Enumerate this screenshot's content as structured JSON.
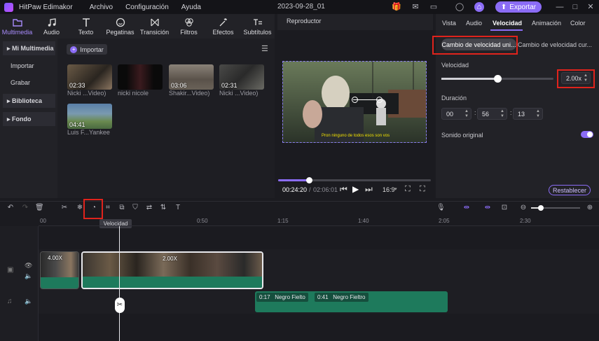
{
  "app": {
    "name": "HitPaw Edimakor",
    "menus": [
      "Archivo",
      "Configuración",
      "Ayuda"
    ],
    "doc_title": "2023-09-28_01",
    "export_label": "Exportar"
  },
  "toolbar": {
    "tabs": [
      "Multimedia",
      "Audio",
      "Texto",
      "Pegatinas",
      "Transición",
      "Filtros",
      "Efectos",
      "Subtítulos"
    ]
  },
  "sidebar": {
    "section_label": "Mi Multimedia",
    "items": [
      "Importar",
      "Grabar"
    ],
    "library_label": "Biblioteca",
    "fondo_label": "Fondo"
  },
  "media": {
    "import_label": "Importar",
    "items": [
      {
        "duration": "02:33",
        "label": "Nicki ...Video)"
      },
      {
        "duration": "",
        "label": "nicki nicole"
      },
      {
        "duration": "03:06",
        "label": "Shakir...Video)"
      },
      {
        "duration": "02:31",
        "label": "Nicki ...Video)"
      },
      {
        "duration": "04:41",
        "label": "Luis F...Yankee"
      }
    ]
  },
  "player": {
    "title": "Reproductor",
    "subtitle": "Pron ninguno de todos esos son vos",
    "time_current": "00:24:20",
    "time_total": "02:06:01",
    "aspect": "16:9",
    "progress": 0.2
  },
  "right": {
    "tabs": [
      "Vista",
      "Audio",
      "Velocidad",
      "Animación",
      "Color"
    ],
    "seg_left": "Cambio de velocidad uni...",
    "seg_right": "Cambio de velocidad cur...",
    "speed_label": "Velocidad",
    "speed_value": "2.00x",
    "speed_level": 0.5,
    "duration_label": "Duración",
    "duration_h": "00",
    "duration_m": "56",
    "duration_s": "13",
    "original_sound_label": "Sonido original",
    "reset_label": "Restablecer"
  },
  "timeline": {
    "tooltip": "Velocidad",
    "ruler": [
      "00",
      "0:50",
      "1:15",
      "1:40",
      "2:05",
      "2:30"
    ],
    "clip1_speed": "4.00X",
    "clip2_speed": "2.00X",
    "audio_tags": [
      {
        "time": "0:17",
        "name": "Negro Fielto"
      },
      {
        "time": "0:41",
        "name": "Negro Fieltro"
      }
    ]
  },
  "colors": {
    "accent": "#8b6cf6",
    "highlight": "#e0231c",
    "audio": "#1e7a5c"
  }
}
